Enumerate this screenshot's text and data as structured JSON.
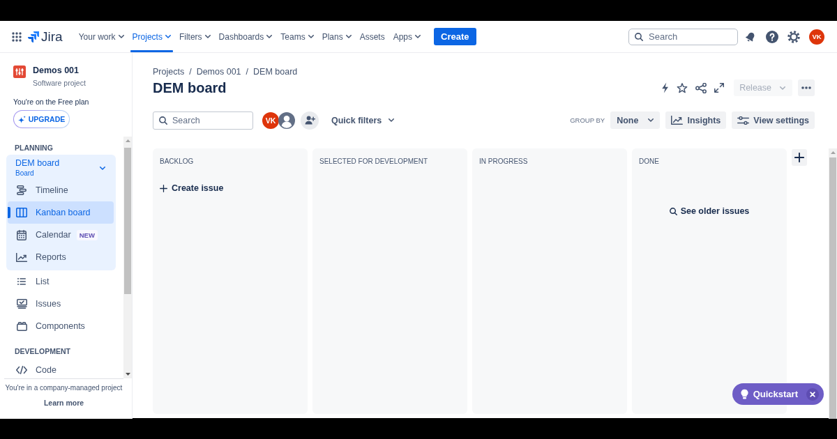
{
  "top_nav": {
    "app_name": "Jira",
    "items": [
      {
        "label": "Your work",
        "dropdown": true,
        "selected": false
      },
      {
        "label": "Projects",
        "dropdown": true,
        "selected": true
      },
      {
        "label": "Filters",
        "dropdown": true,
        "selected": false
      },
      {
        "label": "Dashboards",
        "dropdown": true,
        "selected": false
      },
      {
        "label": "Teams",
        "dropdown": true,
        "selected": false
      },
      {
        "label": "Plans",
        "dropdown": true,
        "selected": false
      },
      {
        "label": "Assets",
        "dropdown": false,
        "selected": false
      },
      {
        "label": "Apps",
        "dropdown": true,
        "selected": false
      }
    ],
    "create_button": "Create",
    "search": {
      "placeholder": "Search"
    },
    "avatar": {
      "initials": "VK"
    }
  },
  "sidebar": {
    "project": {
      "name": "Demos 001",
      "type": "Software project"
    },
    "plan_note": "You're on the Free plan",
    "upgrade_button": "UPGRADE",
    "sections": [
      {
        "heading": "PLANNING",
        "board": {
          "name": "DEM board",
          "type": "Board",
          "expanded": true,
          "items": [
            {
              "kind": "timeline",
              "label": "Timeline",
              "selected": false
            },
            {
              "kind": "board",
              "label": "Kanban board",
              "selected": true
            },
            {
              "kind": "calendar",
              "label": "Calendar",
              "badge": "NEW",
              "selected": false
            },
            {
              "kind": "reports",
              "label": "Reports",
              "selected": false
            }
          ]
        },
        "items": [
          {
            "kind": "list",
            "label": "List",
            "selected": false
          },
          {
            "kind": "issues",
            "label": "Issues",
            "selected": false
          },
          {
            "kind": "components",
            "label": "Components",
            "selected": false
          }
        ]
      },
      {
        "heading": "DEVELOPMENT",
        "items": [
          {
            "kind": "code",
            "label": "Code",
            "selected": false
          }
        ]
      }
    ],
    "footer": {
      "note": "You're in a company-managed project",
      "link": "Learn more"
    }
  },
  "header": {
    "breadcrumbs": {
      "items": [
        "Projects",
        "Demos 001",
        "DEM board"
      ],
      "separator": "/"
    },
    "title": "DEM board",
    "release_button": {
      "label": "Release",
      "disabled": true
    }
  },
  "toolbar": {
    "search": {
      "placeholder": "Search"
    },
    "people": [
      {
        "kind": "initials",
        "initials": "VK"
      },
      {
        "kind": "silhouette"
      }
    ],
    "quick_filters": "Quick filters",
    "group_by": {
      "label": "GROUP BY",
      "value": "None"
    },
    "insights_button": "Insights",
    "view_settings_button": "View settings"
  },
  "board": {
    "columns": [
      {
        "title": "BACKLOG",
        "action": {
          "kind": "create",
          "label": "Create issue"
        }
      },
      {
        "title": "SELECTED FOR DEVELOPMENT"
      },
      {
        "title": "IN PROGRESS"
      },
      {
        "title": "DONE",
        "action": {
          "kind": "history",
          "label": "See older issues"
        }
      }
    ]
  },
  "quickstart": {
    "label": "Quickstart"
  }
}
